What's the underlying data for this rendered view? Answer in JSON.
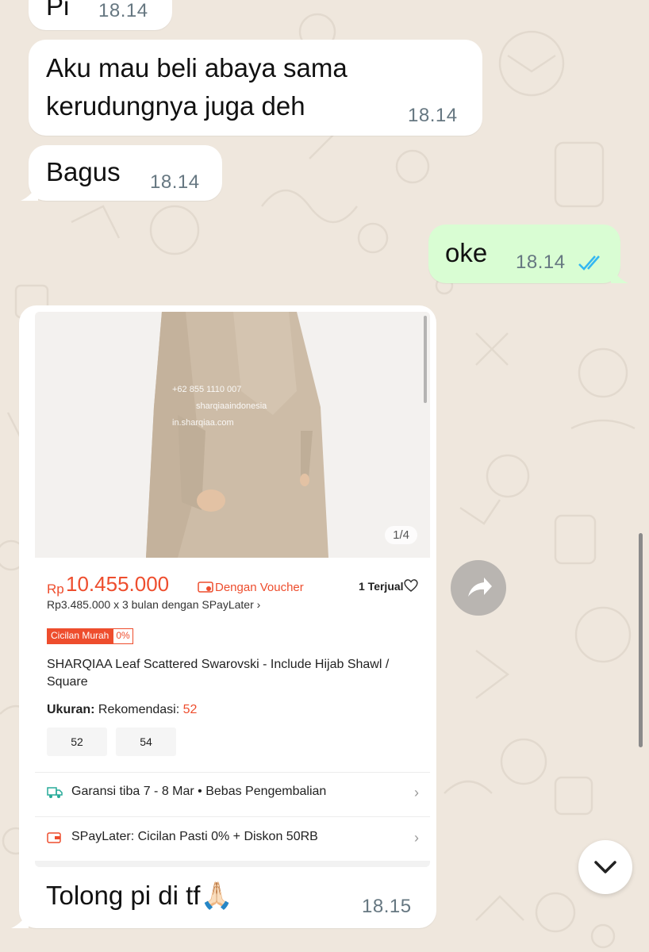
{
  "messages": {
    "m0": {
      "text": "Pi",
      "time": "18.14"
    },
    "m1": {
      "text_line1": "Aku mau beli abaya sama",
      "text_line2": "kerudungnya juga deh",
      "time": "18.14"
    },
    "m2": {
      "text": "Bagus",
      "time": "18.14"
    },
    "m3": {
      "text": "oke",
      "time": "18.14"
    },
    "m4": {
      "text": "Tolong pi di tf🙏🏻",
      "time": "18.15"
    }
  },
  "product": {
    "watermark_phone": "+62 855 1110 007",
    "watermark_social": "sharqiaaindonesia",
    "watermark_site": "in.sharqiaa.com",
    "image_counter": "1/4",
    "currency": "Rp",
    "price": "10.455.000",
    "voucher_label": "Dengan Voucher",
    "sold": "1 Terjual",
    "installment": "Rp3.485.000 x 3 bulan dengan SPayLater",
    "tag_label": "Cicilan Murah",
    "tag_value": "0%",
    "title": "SHARQIAA Leaf Scattered Swarovski - Include Hijab Shawl / Square",
    "size_label": "Ukuran:",
    "size_rec_label": "Rekomendasi:",
    "size_rec_value": "52",
    "size_options": [
      "52",
      "54"
    ],
    "shipping": "Garansi tiba 7 - 8 Mar • Bebas Pengembalian",
    "paylater": "SPayLater: Cicilan Pasti 0% + Diskon 50RB"
  },
  "colors": {
    "accent": "#ee4d2d",
    "outgoing_bubble": "#d9fdd3",
    "read_ticks": "#34b7f1",
    "chat_bg": "#efe7dd"
  },
  "icons": [
    "double-check-icon",
    "heart-icon",
    "truck-icon",
    "wallet-icon",
    "share-icon",
    "chevron-down-icon",
    "pray-emoji"
  ]
}
